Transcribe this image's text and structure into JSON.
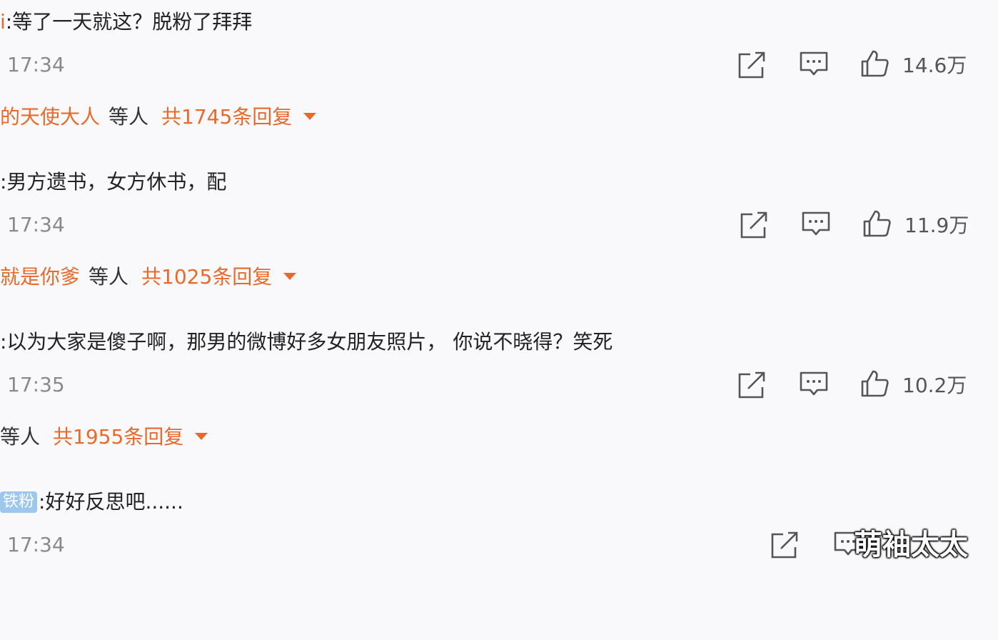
{
  "comments": [
    {
      "name_tail": "i",
      "badge": "",
      "text": ":等了一天就这？脱粉了拜拜",
      "time": "17:34",
      "likes": "14.6万",
      "reply_names": "的天使大人",
      "reply_etc": "等人",
      "reply_total": "共1745条回复"
    },
    {
      "name_tail": "",
      "badge": "",
      "text": ":男方遗书，女方休书，配",
      "time": "17:34",
      "likes": "11.9万",
      "reply_names": "就是你爹",
      "reply_etc": "等人",
      "reply_total": "共1025条回复"
    },
    {
      "name_tail": "",
      "badge": "",
      "text": ":以为大家是傻子啊，那男的微博好多女朋友照片， 你说不晓得？笑死",
      "time": "17:35",
      "likes": "10.2万",
      "reply_names": "",
      "reply_etc": "等人",
      "reply_total": "共1955条回复"
    },
    {
      "name_tail": "",
      "badge": "铁粉",
      "text": ":好好反思吧......",
      "time": "17:34",
      "likes": "",
      "reply_names": "",
      "reply_etc": "",
      "reply_total": ""
    }
  ],
  "icons": {
    "share": "share-icon",
    "comment": "comment-icon",
    "like": "thumbs-up-icon"
  },
  "colors": {
    "accent": "#e86a2b",
    "text": "#222222",
    "muted": "#8a8a8a",
    "badge": "#9ec7ee"
  },
  "watermark": "萌袖太太"
}
